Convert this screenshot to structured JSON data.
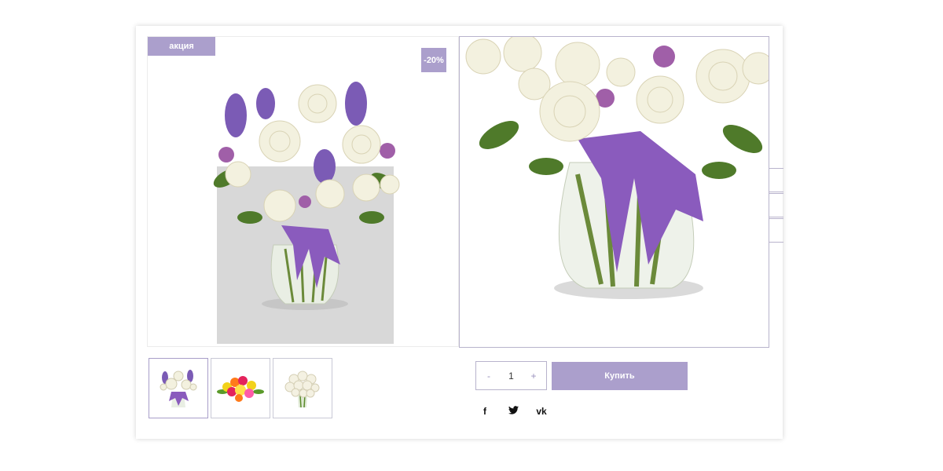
{
  "product": {
    "sale_badge": "акция",
    "discount_badge": "-20%"
  },
  "thumbnails": [
    {
      "name": "purple-white-bouquet"
    },
    {
      "name": "colorful-bouquet"
    },
    {
      "name": "white-roses-bouquet"
    }
  ],
  "purchase": {
    "minus_label": "-",
    "quantity": "1",
    "plus_label": "+",
    "buy_label": "Купить"
  },
  "social": {
    "facebook": "f",
    "twitter": "🐦",
    "vk": "vk"
  },
  "colors": {
    "accent": "#ab9fcc",
    "border": "#b8b3cc"
  },
  "icons": [
    "facebook-icon",
    "twitter-icon",
    "vk-icon"
  ]
}
